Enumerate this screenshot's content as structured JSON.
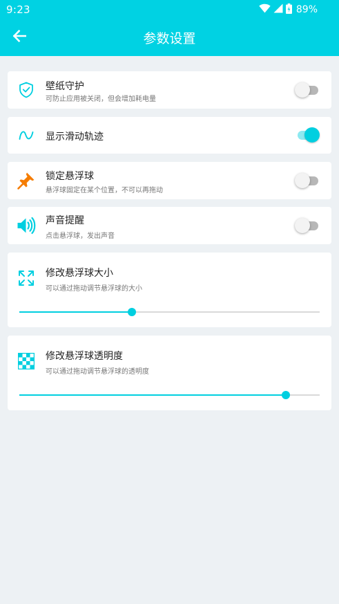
{
  "status": {
    "time": "9:23",
    "battery": "89%"
  },
  "appbar": {
    "title": "参数设置"
  },
  "settings": {
    "wallpaper_guard": {
      "title": "壁纸守护",
      "subtitle": "可防止应用被关闭，但会增加耗电量",
      "enabled": false
    },
    "show_trail": {
      "title": "显示滑动轨迹",
      "enabled": true
    },
    "lock_ball": {
      "title": "锁定悬浮球",
      "subtitle": "悬浮球固定在某个位置，不可以再拖动",
      "enabled": false
    },
    "sound": {
      "title": "声音提醒",
      "subtitle": "点击悬浮球，发出声音",
      "enabled": false
    },
    "size": {
      "title": "修改悬浮球大小",
      "subtitle": "可以通过拖动调节悬浮球的大小",
      "value": 0.375
    },
    "opacity": {
      "title": "修改悬浮球透明度",
      "subtitle": "可以通过拖动调节悬浮球的透明度",
      "value": 0.887
    }
  },
  "colors": {
    "accent": "#00d2e3",
    "pin": "#f57c00",
    "background": "#edf1f4"
  },
  "icons": {
    "back": "arrow-left-icon",
    "wallpaper_guard": "shield-check-icon",
    "show_trail": "wave-icon",
    "lock_ball": "pushpin-icon",
    "sound": "speaker-icon",
    "size": "expand-arrows-icon",
    "opacity": "checkerboard-icon"
  }
}
